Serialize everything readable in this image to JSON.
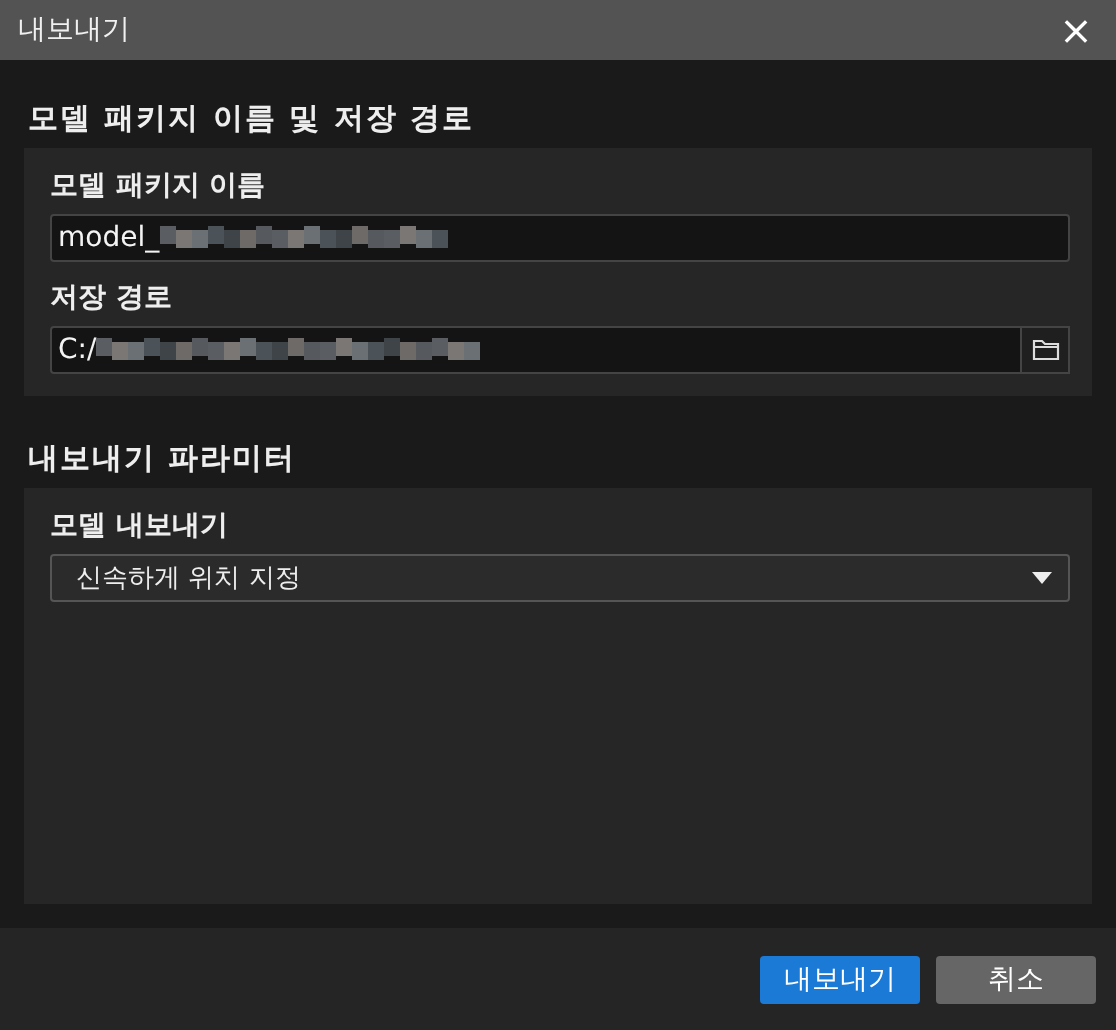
{
  "window": {
    "title": "내보내기",
    "close": "×"
  },
  "sections": [
    {
      "heading": "모델 패키지 이름 및 저장 경로",
      "fields": [
        {
          "kind": "text",
          "label": "모델 패키지 이름",
          "value": "model_"
        },
        {
          "kind": "path",
          "label": "저장 경로",
          "value": "C:/"
        }
      ]
    },
    {
      "heading": "내보내기 파라미터",
      "fields": [
        {
          "kind": "select",
          "label": "모델 내보내기",
          "value": "신속하게 위치 지정"
        }
      ]
    }
  ],
  "buttons": [
    {
      "label": "내보내기",
      "kind": "primary"
    },
    {
      "label": "취소",
      "kind": "secondary"
    }
  ]
}
